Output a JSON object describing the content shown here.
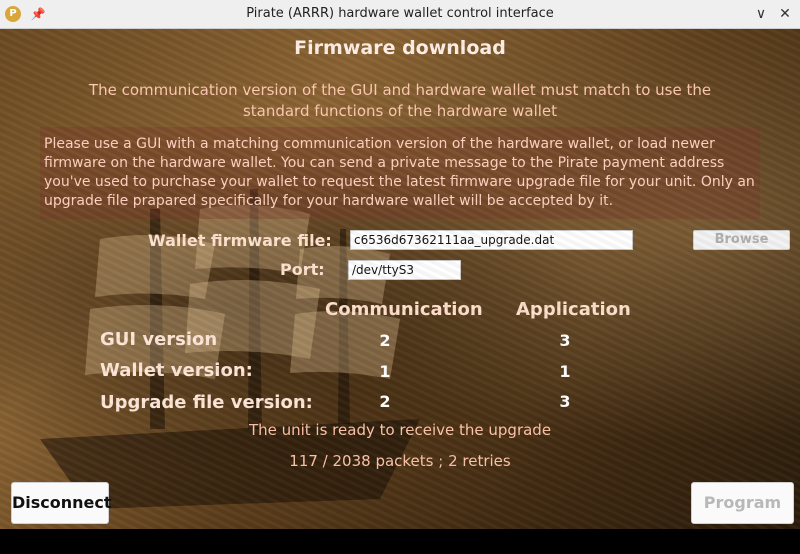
{
  "window": {
    "title": "Pirate (ARRR) hardware wallet control interface",
    "app_icon": "pirate-logo-icon",
    "pin_icon": "pin-icon",
    "minimize_glyph": "∨",
    "close_glyph": "✕"
  },
  "page": {
    "heading": "Firmware download",
    "subtitle": "The communication version of the GUI and hardware wallet must match to use the standard functions of the hardware wallet",
    "info": "Please use a GUI with a matching communication version of the hardware wallet, or load newer firmware on the hardware wallet. You can send a private message to the Pirate payment address you've used to purchase your wallet to request the latest firmware upgrade file for your unit. Only an upgrade file prapared specifically for your hardware wallet will be accepted by it."
  },
  "form": {
    "firmware_label": "Wallet firmware file:",
    "firmware_value": "c6536d67362111aa_upgrade.dat",
    "browse_label": "Browse",
    "port_label": "Port:",
    "port_value": "/dev/ttyS3"
  },
  "versions": {
    "col_communication": "Communication",
    "col_application": "Application",
    "rows": [
      {
        "label": "GUI version",
        "communication": "2",
        "application": "3"
      },
      {
        "label": "Wallet version:",
        "communication": "1",
        "application": "1"
      },
      {
        "label": "Upgrade file version:",
        "communication": "2",
        "application": "3"
      }
    ]
  },
  "status": {
    "ready": "The unit is ready to receive the upgrade",
    "progress": "117 / 2038 packets ; 2 retries"
  },
  "buttons": {
    "disconnect": "Disconnect",
    "program": "Program"
  },
  "colors": {
    "accent_text": "#ffd9c2",
    "disabled_text": "#b8b8b8"
  }
}
